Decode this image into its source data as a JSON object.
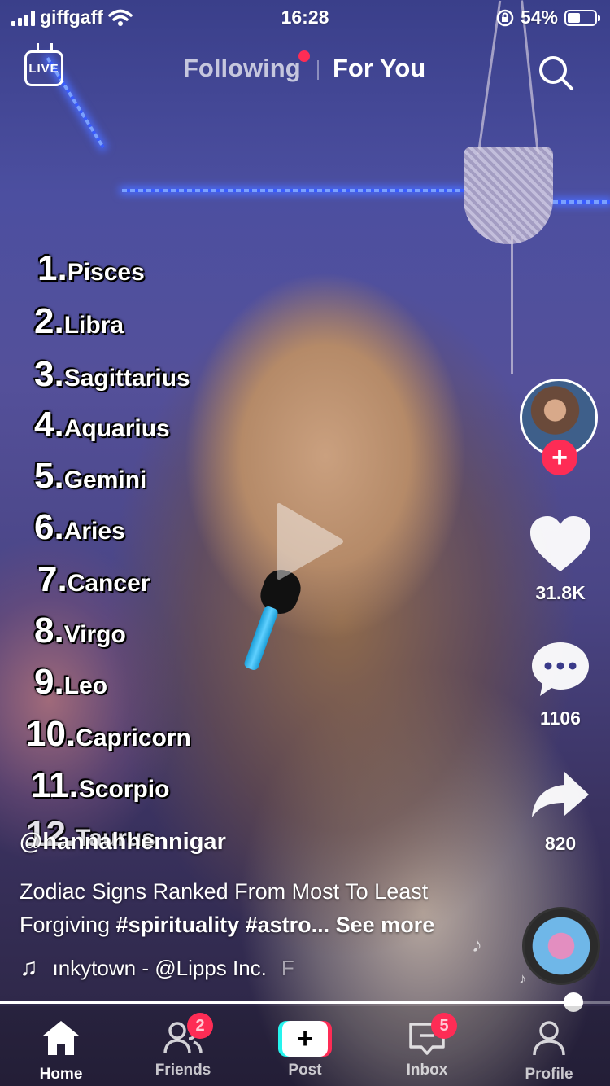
{
  "status_bar": {
    "carrier": "giffgaff",
    "time": "16:28",
    "battery": "54%",
    "battery_level": 0.54
  },
  "top_nav": {
    "live_label": "LIVE",
    "following_label": "Following",
    "for_you_label": "For You"
  },
  "video_overlay": {
    "items": [
      {
        "num": "1.",
        "sign": "Pisces"
      },
      {
        "num": "2.",
        "sign": "Libra"
      },
      {
        "num": "3.",
        "sign": "Sagittarius"
      },
      {
        "num": "4.",
        "sign": "Aquarius"
      },
      {
        "num": "5.",
        "sign": "Gemini"
      },
      {
        "num": "6.",
        "sign": "Aries"
      },
      {
        "num": "7.",
        "sign": "Cancer"
      },
      {
        "num": "8.",
        "sign": "Virgo"
      },
      {
        "num": "9.",
        "sign": "Leo"
      },
      {
        "num": "10.",
        "sign": "Capricorn"
      },
      {
        "num": "11.",
        "sign": "Scorpio"
      },
      {
        "num": "12.",
        "sign": "Taurus"
      }
    ]
  },
  "actions": {
    "likes": "31.8K",
    "comments": "1106",
    "shares": "820"
  },
  "caption": {
    "username": "@hannahhennigar",
    "description_text": "Zodiac Signs Ranked From Most To Least Forgiving ",
    "hashtags": "#spirituality #astro...",
    "see_more": " See more",
    "sound": "ınkytown - @Lipps Inc.",
    "sound_tail": "F"
  },
  "progress": 0.94,
  "tab_bar": {
    "home": "Home",
    "friends": "Friends",
    "friends_badge": "2",
    "post": "Post",
    "inbox": "Inbox",
    "inbox_badge": "5",
    "profile": "Profile"
  },
  "colors": {
    "accent_red": "#fe2c55",
    "accent_cyan": "#25f4ee"
  }
}
